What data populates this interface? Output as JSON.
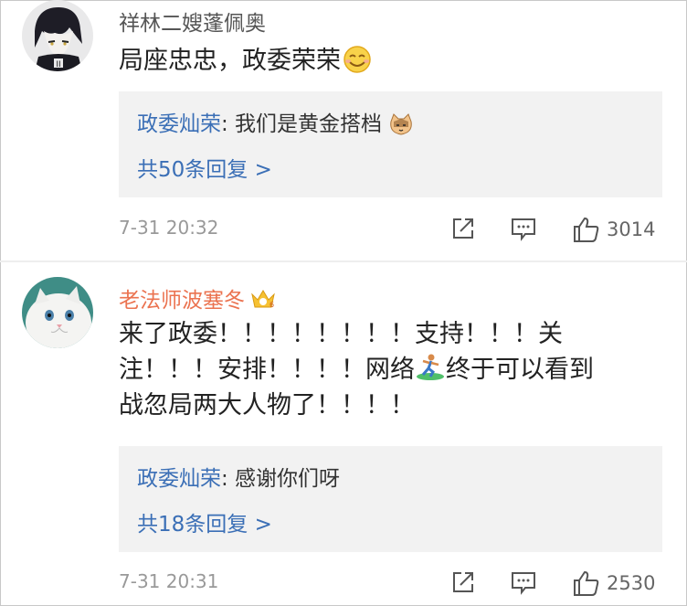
{
  "comments": [
    {
      "username": "祥林二嫂蓬佩奥",
      "text": "局座忠忠，政委荣荣",
      "emoji": "smile-emoji",
      "reply": {
        "user": "政委灿荣",
        "text": ": 我们是黄金搭档",
        "emoji": "cat-emoji"
      },
      "more": "共50条回复 >",
      "time": "7-31 20:32",
      "likes": "3014"
    },
    {
      "username": "老法师波塞冬",
      "badge": "crown-badge-icon",
      "text_lines": [
        "来了政委！！！！！！！！支持！！！关",
        "注！！！安排！！！！网络",
        "终于可以看到",
        "战忽局两大人物了！！！！"
      ],
      "emoji": "surfer-emoji",
      "reply": {
        "user": "政委灿荣",
        "text": ": 感谢你们呀"
      },
      "more": "共18条回复 >",
      "time": "7-31 20:31",
      "likes": "2530"
    }
  ],
  "colors": {
    "username_gray": "#555555",
    "username_orange": "#eb7350",
    "link_blue": "#3b6fb6",
    "reply_bg": "#f2f2f2",
    "meta_gray": "#999999"
  }
}
